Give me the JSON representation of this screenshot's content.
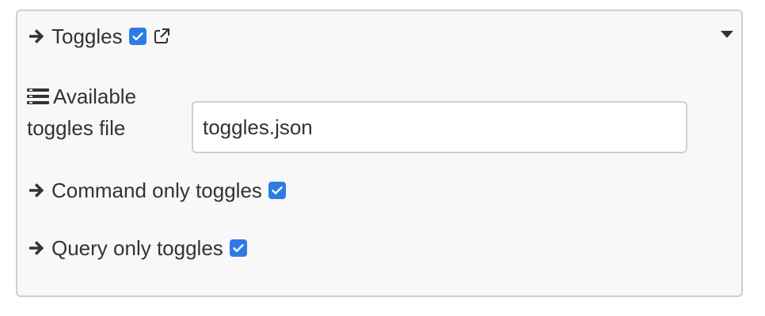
{
  "panel": {
    "title": "Toggles",
    "title_checked": true,
    "icons": {
      "title_arrow": "arrow-right-icon",
      "external_link": "external-link-icon",
      "collapse_caret": "caret-down-icon"
    }
  },
  "fields": {
    "toggles_file": {
      "label": "Available toggles file",
      "icon": "list-icon",
      "value": "toggles.json"
    },
    "command_only": {
      "label": "Command only toggles",
      "checked": true
    },
    "query_only": {
      "label": "Query only toggles",
      "checked": true
    }
  },
  "colors": {
    "checkbox": "#2f7be6",
    "panel_background": "#f8f8f8",
    "panel_border": "#cfcfcf",
    "text": "#333333"
  }
}
